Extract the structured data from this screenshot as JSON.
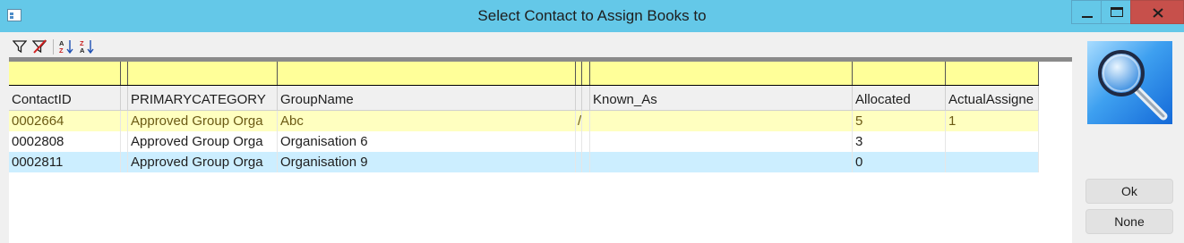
{
  "window": {
    "title": "Select Contact to Assign Books to"
  },
  "toolbar": {
    "icons": [
      "filter-icon",
      "clear-filter-icon",
      "sort-ascending-icon",
      "sort-descending-icon"
    ]
  },
  "grid": {
    "columns": [
      "ContactID",
      "PRIMARYCATEGORY",
      "GroupName",
      "",
      "",
      "Known_As",
      "Allocated",
      "ActualAssigne"
    ],
    "rows": [
      {
        "contact_id": "0002664",
        "primary_category": "Approved Group Orga",
        "group_name": "Abc",
        "narrow": "/",
        "known_as": "",
        "allocated": "5",
        "actual_assigned": "1"
      },
      {
        "contact_id": "0002808",
        "primary_category": "Approved Group Orga",
        "group_name": "Organisation 6",
        "narrow": "",
        "known_as": "",
        "allocated": "3",
        "actual_assigned": ""
      },
      {
        "contact_id": "0002811",
        "primary_category": "Approved Group Orga",
        "group_name": "Organisation 9",
        "narrow": "",
        "known_as": "",
        "allocated": "0",
        "actual_assigned": ""
      }
    ]
  },
  "side_panel": {
    "ok_label": "Ok",
    "none_label": "None",
    "image_icon": "magnifier-icon"
  },
  "colors": {
    "titlebar": "#64c8e8",
    "close_button": "#c7504b",
    "filter_row": "#ffff99",
    "selected_row": "#ffffc0",
    "alt_row": "#cceeff"
  }
}
